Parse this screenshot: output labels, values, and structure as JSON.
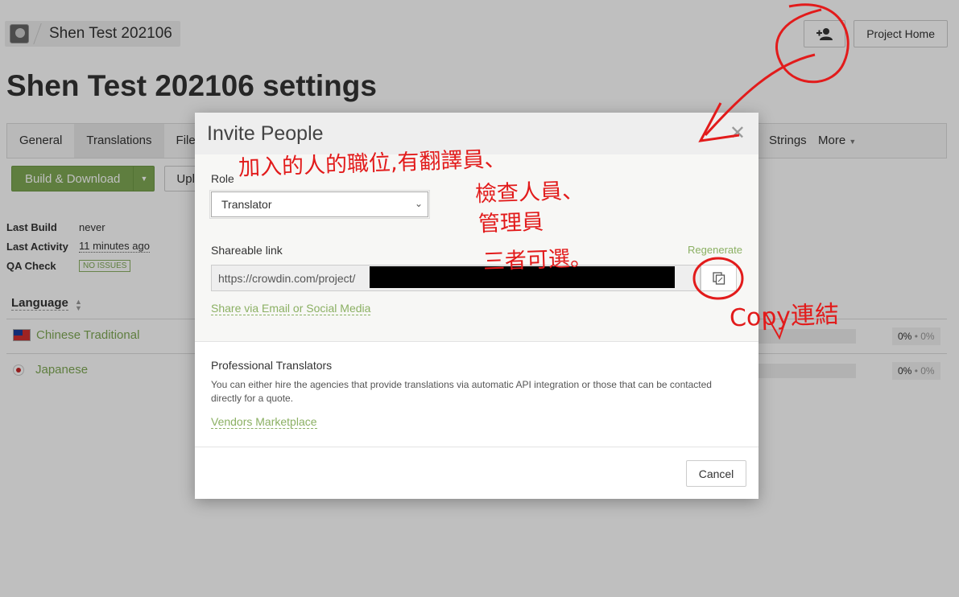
{
  "breadcrumb": {
    "project_name": "Shen Test 202106"
  },
  "header": {
    "project_home_label": "Project Home"
  },
  "page": {
    "title": "Shen Test 202106 settings"
  },
  "tabs": [
    {
      "label": "General"
    },
    {
      "label": "Translations"
    },
    {
      "label": "Files"
    },
    {
      "label": "Strings"
    },
    {
      "label": "More"
    }
  ],
  "actions": {
    "build_label": "Build & Download",
    "upload_label": "Uplo"
  },
  "stats": {
    "last_build_key": "Last Build",
    "last_build_val": "never",
    "last_activity_key": "Last Activity",
    "last_activity_val": "11 minutes ago",
    "qa_key": "QA Check",
    "qa_val": "NO ISSUES"
  },
  "languages": {
    "header": "Language",
    "items": [
      {
        "name": "Chinese Traditional",
        "pct": "0%",
        "pct_sub": "0%",
        "progress": 0
      },
      {
        "name": "Japanese",
        "pct": "0%",
        "pct_sub": "0%",
        "progress": 0
      }
    ]
  },
  "modal": {
    "title": "Invite People",
    "role_label": "Role",
    "role_value": "Translator",
    "share_label": "Shareable link",
    "regenerate": "Regenerate",
    "link_prefix": "https://crowdin.com/project/",
    "share_social": "Share via Email or Social Media",
    "pro_title": "Professional Translators",
    "pro_desc": "You can either hire the agencies that provide translations via automatic API integration or those that can be contacted directly for a quote.",
    "vendors": "Vendors Marketplace",
    "cancel": "Cancel"
  },
  "annotations": {
    "role_note_line1": "加入的人的職位,有翻譯員、",
    "role_note_line2": "檢查人員、",
    "role_note_line3": "管理員",
    "role_note_line4": "三者可選。",
    "copy_note": "Copy連結"
  },
  "colors": {
    "accent": "#7fa955",
    "annotation": "#e21b1b"
  }
}
